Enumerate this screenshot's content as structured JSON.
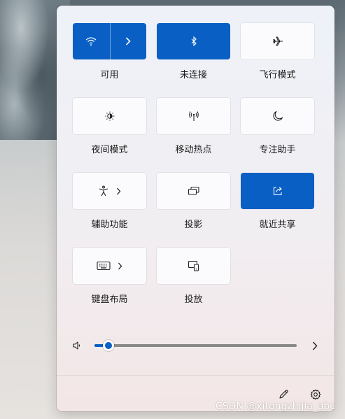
{
  "quick_settings": {
    "tiles": [
      {
        "id": "wifi",
        "label": "可用",
        "state": "on",
        "icon": "wifi-icon",
        "has_arrow": true
      },
      {
        "id": "bluetooth",
        "label": "未连接",
        "state": "on",
        "icon": "bluetooth-icon"
      },
      {
        "id": "airplane",
        "label": "飞行模式",
        "state": "off",
        "icon": "airplane-icon"
      },
      {
        "id": "night_light",
        "label": "夜间模式",
        "state": "off",
        "icon": "brightness-icon"
      },
      {
        "id": "hotspot",
        "label": "移动热点",
        "state": "off",
        "icon": "hotspot-icon"
      },
      {
        "id": "focus_assist",
        "label": "专注助手",
        "state": "off",
        "icon": "moon-icon"
      },
      {
        "id": "accessibility",
        "label": "辅助功能",
        "state": "off",
        "icon": "accessibility-icon",
        "has_arrow": true
      },
      {
        "id": "project",
        "label": "投影",
        "state": "off",
        "icon": "project-icon"
      },
      {
        "id": "nearby_share",
        "label": "就近共享",
        "state": "on",
        "icon": "share-icon"
      },
      {
        "id": "keyboard_layout",
        "label": "键盘布局",
        "state": "off",
        "icon": "keyboard-icon",
        "has_arrow": true
      },
      {
        "id": "cast",
        "label": "投放",
        "state": "off",
        "icon": "cast-icon"
      }
    ],
    "volume": {
      "level": 0.07,
      "icon": "speaker-icon"
    },
    "footer": {
      "edit_icon": "pencil-icon",
      "settings_icon": "gear-icon"
    }
  },
  "watermark": "CSDN @xitongzhijia_abc",
  "colors": {
    "accent": "#0a5fc4",
    "tile_off": "#fbfbfd"
  }
}
